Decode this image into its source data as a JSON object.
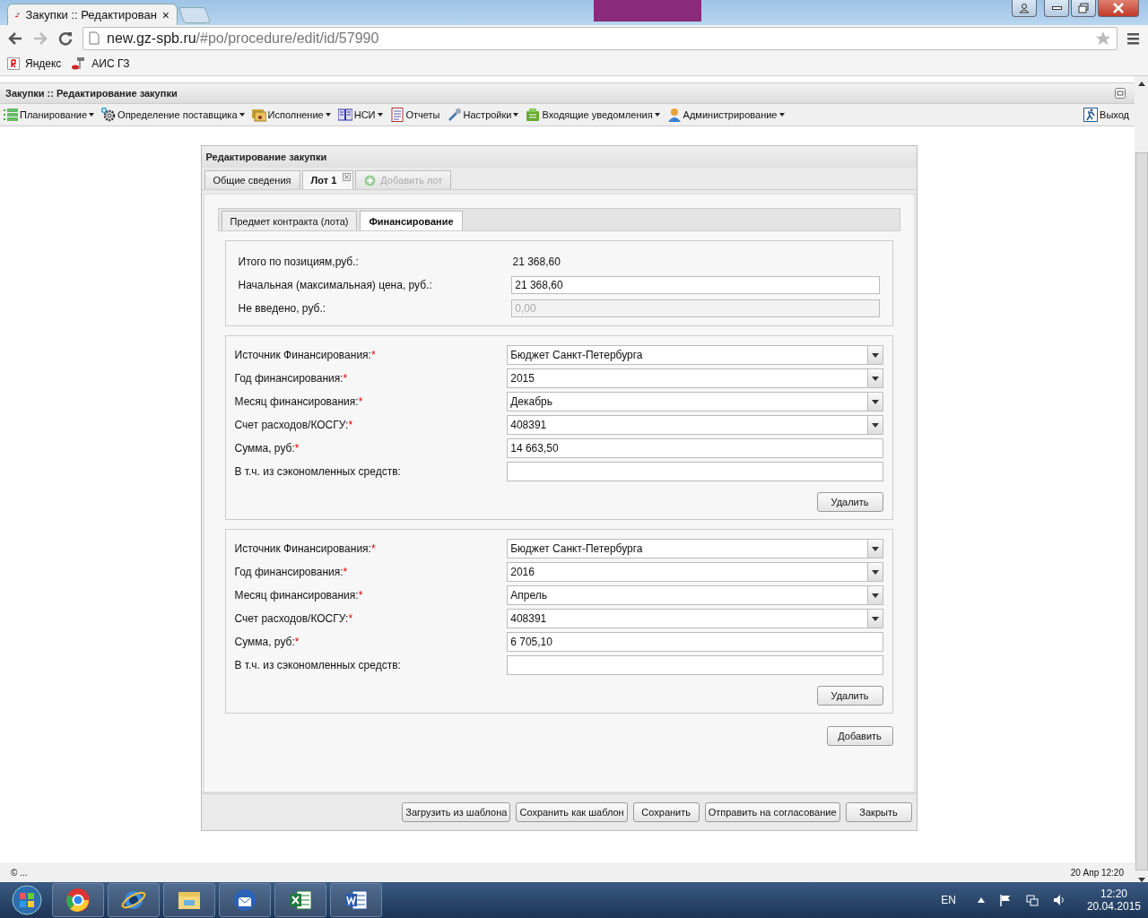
{
  "browser": {
    "tab_title": "Закупки :: Редактирован",
    "tab_close": "×",
    "url_host": "new.gz-spb.ru",
    "url_path": "/#po/procedure/edit/id/57990",
    "bookmarks": [
      "Яндекс",
      "АИС ГЗ"
    ]
  },
  "app": {
    "title": "Закупки :: Редактирование закупки",
    "menu": [
      {
        "label": "Планирование",
        "dropdown": true
      },
      {
        "label": "Определение поставщика",
        "dropdown": true
      },
      {
        "label": "Исполнение",
        "dropdown": true
      },
      {
        "label": "НСИ",
        "dropdown": true
      },
      {
        "label": "Отчеты",
        "dropdown": false
      },
      {
        "label": "Настройки",
        "dropdown": true
      },
      {
        "label": "Входящие уведомления",
        "dropdown": true
      },
      {
        "label": "Администрирование",
        "dropdown": true
      }
    ],
    "logout": "Выход"
  },
  "dialog": {
    "title": "Редактирование закупки",
    "tabs": [
      {
        "label": "Общие сведения",
        "selected": false,
        "disabled": false,
        "closable": false
      },
      {
        "label": "Лот 1",
        "selected": true,
        "disabled": false,
        "closable": true
      },
      {
        "label": "Добавить лот",
        "selected": false,
        "disabled": true,
        "closable": false
      }
    ],
    "subtabs": [
      {
        "label": "Предмет контракта (лота)",
        "selected": false
      },
      {
        "label": "Финансирование",
        "selected": true
      }
    ],
    "summary": [
      {
        "label": "Итого по позициям,руб.:",
        "value": "21 368,60",
        "kind": "text"
      },
      {
        "label": "Начальная (максимальная) цена, руб.:",
        "value": "21 368,60",
        "kind": "input"
      },
      {
        "label": "Не введено, руб.:",
        "value": "0,00",
        "kind": "disabled"
      }
    ],
    "funding": [
      {
        "fields": [
          {
            "label": "Источник Финансирования:",
            "mark": "*",
            "value": "Бюджет Санкт-Петербурга",
            "kind": "select"
          },
          {
            "label": "Год финансирования:",
            "mark": "*",
            "value": "2015",
            "kind": "select"
          },
          {
            "label": "Месяц финансирования:",
            "mark": "*",
            "value": "Декабрь",
            "kind": "select"
          },
          {
            "label": "Счет расходов/КОСГУ:",
            "mark": "*",
            "value": "408391",
            "kind": "select"
          },
          {
            "label": "Сумма, руб:",
            "mark": "*",
            "value": "14 663,50",
            "kind": "input"
          },
          {
            "label": "В т.ч. из сэкономленных средств:",
            "kind": "input"
          }
        ],
        "delete": "Удалить"
      },
      {
        "fields": [
          {
            "label": "Источник Финансирования:",
            "mark": "*",
            "value": "Бюджет Санкт-Петербурга",
            "kind": "select"
          },
          {
            "label": "Год финансирования:",
            "mark": "*",
            "value": "2016",
            "kind": "select"
          },
          {
            "label": "Месяц финансирования:",
            "mark": "*",
            "value": "Апрель",
            "kind": "select"
          },
          {
            "label": "Счет расходов/КОСГУ:",
            "mark": "*",
            "value": "408391",
            "kind": "select"
          },
          {
            "label": "Сумма, руб:",
            "mark": "*",
            "value": "6 705,10",
            "kind": "input"
          },
          {
            "label": "В т.ч. из сэкономленных средств:",
            "kind": "input"
          }
        ],
        "delete": "Удалить"
      }
    ],
    "add": "Добавить",
    "footer_buttons": [
      "Загрузить из шаблона",
      "Сохранить как шаблон",
      "Сохранить",
      "Отправить на согласование",
      "Закрыть"
    ]
  },
  "status": {
    "left": "© ...",
    "right": "20 Апр 12:20"
  },
  "taskbar": {
    "lang": "EN",
    "time": "12:20",
    "date": "20.04.2015"
  }
}
